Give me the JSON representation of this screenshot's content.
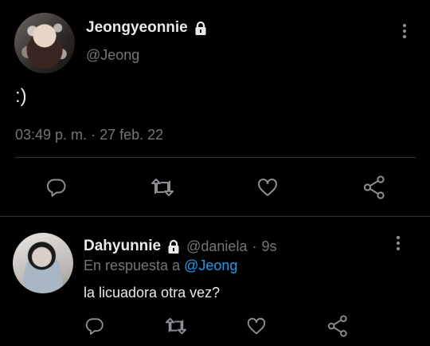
{
  "main_tweet": {
    "display_name": "Jeongyeonnie",
    "handle": "@Jeong",
    "text": ":)",
    "time": "03:49 p. m.",
    "separator": "·",
    "date": "27 feb. 22"
  },
  "reply": {
    "display_name": "Dahyunnie",
    "handle": "@daniela",
    "separator": "·",
    "age": "9s",
    "replying_prefix": "En respuesta a",
    "replying_to": "@Jeong",
    "text": "la licuadora otra vez?"
  },
  "colors": {
    "background": "#000000",
    "primary_text": "#e7e9ea",
    "secondary_text": "#71767b",
    "accent": "#1d9bf0",
    "divider": "#2f3336"
  },
  "icons": [
    "lock-icon",
    "more-vertical-icon",
    "reply-icon",
    "retweet-icon",
    "like-icon",
    "share-icon"
  ]
}
